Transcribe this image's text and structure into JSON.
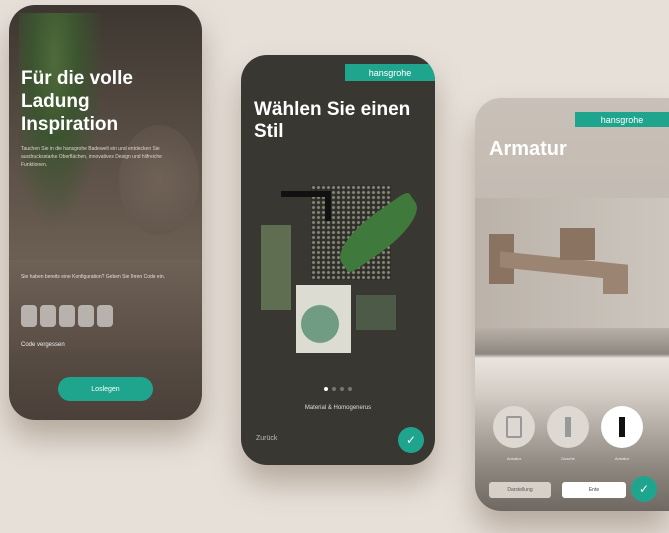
{
  "phone1": {
    "title": "Für die volle Ladung Inspiration",
    "body": "Tauchen Sie in die hansgrohe Badewelt ein und entdecken Sie ausdrucksstarke Oberflächen, innovatives Design und hilfreiche Funktionen.",
    "code_question": "Sie haben bereits eine Konfiguration? Geben Sie Ihren Code ein.",
    "forgot_code": "Code vergessen",
    "start_button": "Loslegen"
  },
  "phone2": {
    "logo": "hansgrohe",
    "title": "Wählen Sie einen Stil",
    "caption": "Material & Homogenerus",
    "back": "Zurück",
    "check": "✓"
  },
  "phone3": {
    "logo": "hansgrohe",
    "title": "Armatur",
    "options": [
      "Armatur",
      "Dusche",
      "Armatur"
    ],
    "button_left": "Darstellung",
    "button_right": "Ente",
    "check": "✓"
  },
  "colors": {
    "accent": "#1fa58d",
    "background": "#e7e0d9",
    "dark_panel": "#383731"
  }
}
